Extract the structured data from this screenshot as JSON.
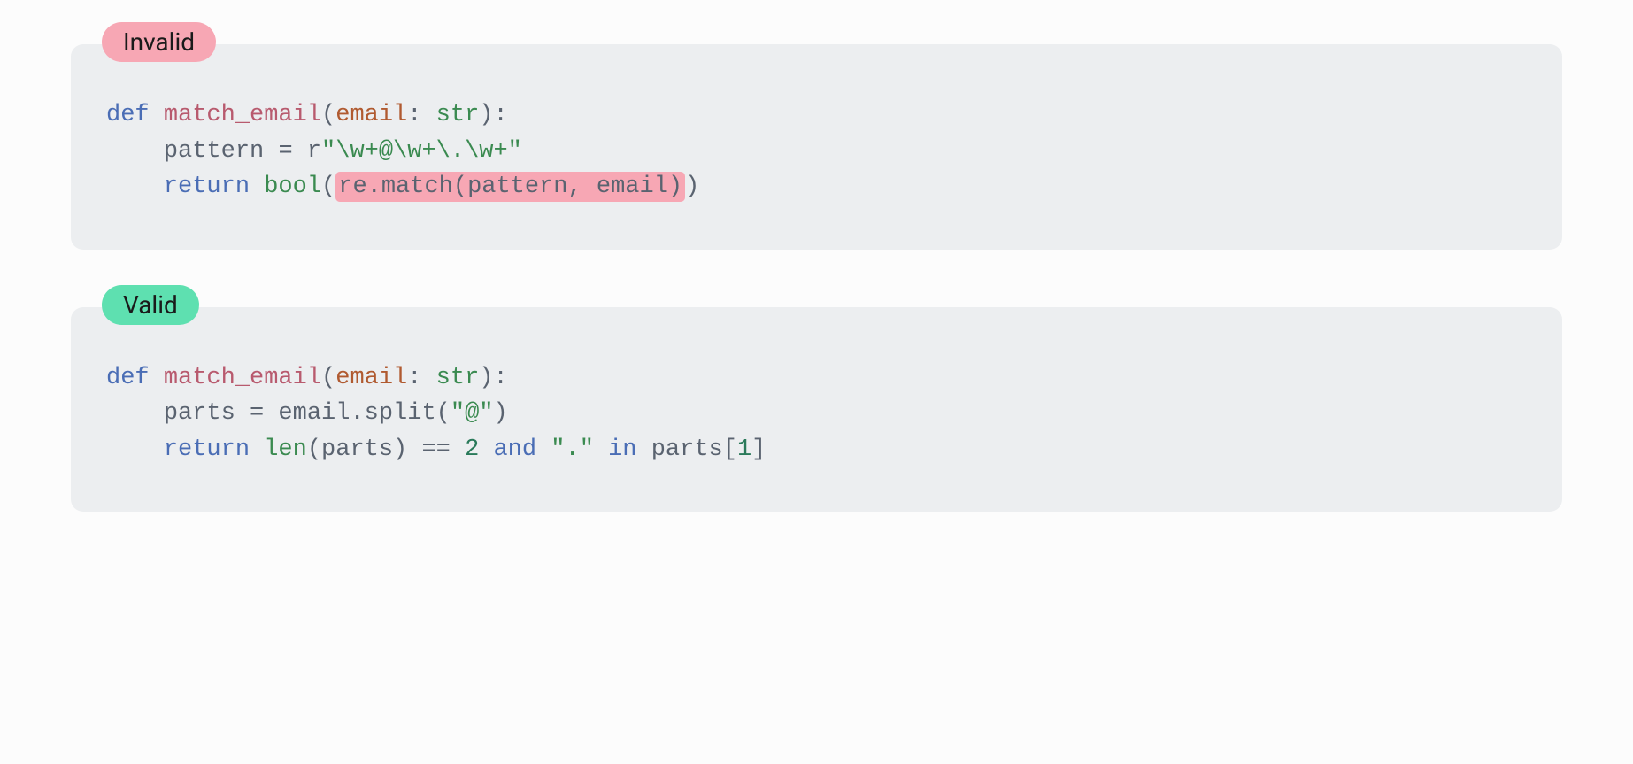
{
  "blocks": [
    {
      "badge": "Invalid",
      "badgeClass": "badge-invalid",
      "code": {
        "line1_def": "def",
        "line1_fn": "match_email",
        "line1_open": "(",
        "line1_param": "email",
        "line1_colon": ": ",
        "line1_type": "str",
        "line1_close": "):",
        "line2_indent": "    ",
        "line2_var": "pattern ",
        "line2_eq": "=",
        "line2_sp": " r",
        "line2_str": "\"\\w+@\\w+\\.\\w+\"",
        "line3_indent": "    ",
        "line3_ret": "return",
        "line3_sp": " ",
        "line3_bool": "bool",
        "line3_open": "(",
        "line3_hl": "re.match(pattern, email)",
        "line3_close": ")"
      }
    },
    {
      "badge": "Valid",
      "badgeClass": "badge-valid",
      "code": {
        "line1_def": "def",
        "line1_fn": "match_email",
        "line1_open": "(",
        "line1_param": "email",
        "line1_colon": ": ",
        "line1_type": "str",
        "line1_close": "):",
        "line2_indent": "    ",
        "line2_parts": "parts ",
        "line2_eq": "=",
        "line2_sp": " email.split(",
        "line2_str": "\"@\"",
        "line2_close": ")",
        "line3_indent": "    ",
        "line3_ret": "return",
        "line3_sp1": " ",
        "line3_len": "len",
        "line3_p1": "(parts) ",
        "line3_eqeq": "==",
        "line3_sp2": " ",
        "line3_num": "2",
        "line3_sp3": " ",
        "line3_and": "and",
        "line3_sp4": " ",
        "line3_dot": "\".\"",
        "line3_sp5": " ",
        "line3_in": "in",
        "line3_sp6": " parts[",
        "line3_idx": "1",
        "line3_br": "]"
      }
    }
  ]
}
